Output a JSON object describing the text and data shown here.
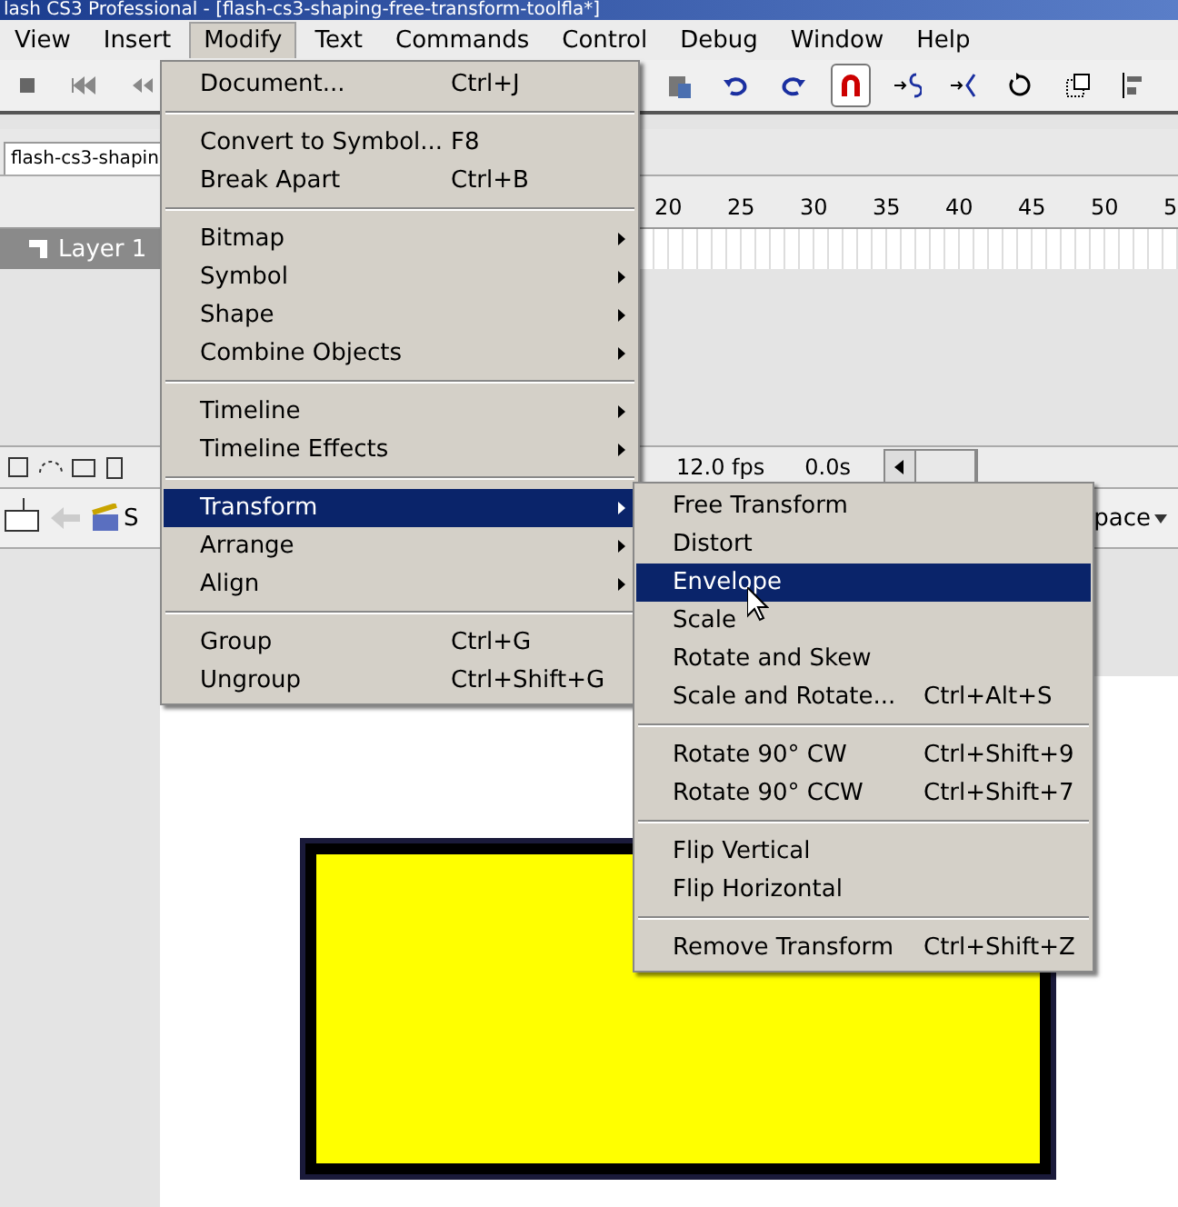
{
  "window": {
    "title": "lash CS3 Professional - [flash-cs3-shaping-free-transform-toolfla*]"
  },
  "menubar": [
    {
      "label": "View",
      "selected": false
    },
    {
      "label": "Insert",
      "selected": false
    },
    {
      "label": "Modify",
      "selected": true
    },
    {
      "label": "Text",
      "selected": false
    },
    {
      "label": "Commands",
      "selected": false
    },
    {
      "label": "Control",
      "selected": false
    },
    {
      "label": "Debug",
      "selected": false
    },
    {
      "label": "Window",
      "selected": false
    },
    {
      "label": "Help",
      "selected": false
    }
  ],
  "toolbar": {
    "left": [
      {
        "kind": "stop",
        "selected": false
      },
      {
        "kind": "first",
        "selected": false
      },
      {
        "kind": "back",
        "selected": false
      }
    ],
    "right": [
      {
        "kind": "paste",
        "selected": false
      },
      {
        "kind": "undo",
        "selected": false
      },
      {
        "kind": "redo",
        "selected": false
      },
      {
        "kind": "magnet",
        "selected": true
      },
      {
        "kind": "smooth",
        "selected": false
      },
      {
        "kind": "straighten",
        "selected": false
      },
      {
        "kind": "rotate",
        "selected": false
      },
      {
        "kind": "scale",
        "selected": false
      },
      {
        "kind": "align",
        "selected": false
      }
    ]
  },
  "document_tab": {
    "label": "flash-cs3-shapin"
  },
  "timeline": {
    "frame_numbers": [
      "20",
      "25",
      "30",
      "35",
      "40",
      "45",
      "50",
      "5"
    ],
    "layers": [
      {
        "name": "Layer 1",
        "selected": true
      }
    ],
    "fps": "12.0 fps",
    "time": "0.0s"
  },
  "edit_bar": {
    "scene_label": "S",
    "workspace_label": "pace"
  },
  "menu": {
    "items": [
      {
        "kind": "item",
        "label": "Document...",
        "shortcut": "Ctrl+J",
        "submenu": false,
        "selected": false
      },
      {
        "kind": "separator"
      },
      {
        "kind": "item",
        "label": "Convert to Symbol...",
        "shortcut": "F8",
        "submenu": false,
        "selected": false
      },
      {
        "kind": "item",
        "label": "Break Apart",
        "shortcut": "Ctrl+B",
        "submenu": false,
        "selected": false
      },
      {
        "kind": "separator"
      },
      {
        "kind": "item",
        "label": "Bitmap",
        "submenu": true,
        "selected": false
      },
      {
        "kind": "item",
        "label": "Symbol",
        "submenu": true,
        "selected": false
      },
      {
        "kind": "item",
        "label": "Shape",
        "submenu": true,
        "selected": false
      },
      {
        "kind": "item",
        "label": "Combine Objects",
        "submenu": true,
        "selected": false
      },
      {
        "kind": "separator"
      },
      {
        "kind": "item",
        "label": "Timeline",
        "submenu": true,
        "selected": false
      },
      {
        "kind": "item",
        "label": "Timeline Effects",
        "submenu": true,
        "selected": false
      },
      {
        "kind": "separator"
      },
      {
        "kind": "item",
        "label": "Transform",
        "submenu": true,
        "selected": true
      },
      {
        "kind": "item",
        "label": "Arrange",
        "submenu": true,
        "selected": false
      },
      {
        "kind": "item",
        "label": "Align",
        "submenu": true,
        "selected": false
      },
      {
        "kind": "separator"
      },
      {
        "kind": "item",
        "label": "Group",
        "shortcut": "Ctrl+G",
        "submenu": false,
        "selected": false
      },
      {
        "kind": "item",
        "label": "Ungroup",
        "shortcut": "Ctrl+Shift+G",
        "submenu": false,
        "selected": false
      }
    ]
  },
  "submenu": {
    "items": [
      {
        "kind": "item",
        "label": "Free Transform",
        "submenu": false,
        "selected": false
      },
      {
        "kind": "item",
        "label": "Distort",
        "submenu": false,
        "selected": false
      },
      {
        "kind": "item",
        "label": "Envelope",
        "submenu": false,
        "selected": true
      },
      {
        "kind": "item",
        "label": "Scale",
        "submenu": false,
        "selected": false
      },
      {
        "kind": "item",
        "label": "Rotate and Skew",
        "submenu": false,
        "selected": false
      },
      {
        "kind": "item",
        "label": "Scale and Rotate...",
        "shortcut": "Ctrl+Alt+S",
        "submenu": false,
        "selected": false
      },
      {
        "kind": "separator"
      },
      {
        "kind": "item",
        "label": "Rotate 90° CW",
        "shortcut": "Ctrl+Shift+9",
        "submenu": false,
        "selected": false
      },
      {
        "kind": "item",
        "label": "Rotate 90° CCW",
        "shortcut": "Ctrl+Shift+7",
        "submenu": false,
        "selected": false
      },
      {
        "kind": "separator"
      },
      {
        "kind": "item",
        "label": "Flip Vertical",
        "submenu": false,
        "selected": false
      },
      {
        "kind": "item",
        "label": "Flip Horizontal",
        "submenu": false,
        "selected": false
      },
      {
        "kind": "separator"
      },
      {
        "kind": "item",
        "label": "Remove Transform",
        "shortcut": "Ctrl+Shift+Z",
        "submenu": false,
        "selected": false
      }
    ]
  }
}
